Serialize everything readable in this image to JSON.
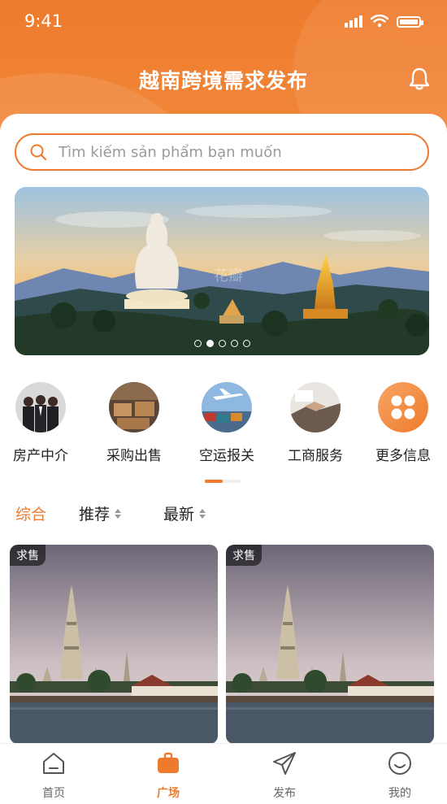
{
  "status_bar": {
    "time": "9:41"
  },
  "header": {
    "title": "越南跨境需求发布"
  },
  "search": {
    "placeholder": "Tìm kiếm sản phẩm bạn muốn"
  },
  "banner": {
    "dot_count": 5,
    "active_dot": 1,
    "watermark": "花瓣"
  },
  "categories": [
    {
      "label": "房产中介",
      "icon": "real-estate-agents"
    },
    {
      "label": "采购出售",
      "icon": "purchase-warehouse"
    },
    {
      "label": "空运报关",
      "icon": "air-freight"
    },
    {
      "label": "工商服务",
      "icon": "business-handshake"
    },
    {
      "label": "更多信息",
      "icon": "grid-icon"
    }
  ],
  "filters": [
    {
      "label": "综合",
      "active": true
    },
    {
      "label": "推荐",
      "sortable": true
    },
    {
      "label": "最新",
      "sortable": true
    }
  ],
  "products": [
    {
      "tag": "求售"
    },
    {
      "tag": "求售"
    }
  ],
  "tabbar": [
    {
      "label": "首页",
      "icon": "home-icon"
    },
    {
      "label": "广场",
      "icon": "briefcase-icon",
      "active": true
    },
    {
      "label": "发布",
      "icon": "send-icon"
    },
    {
      "label": "我的",
      "icon": "smile-icon"
    }
  ],
  "colors": {
    "accent": "#ee7b2d",
    "text": "#222222",
    "muted": "#666666"
  }
}
